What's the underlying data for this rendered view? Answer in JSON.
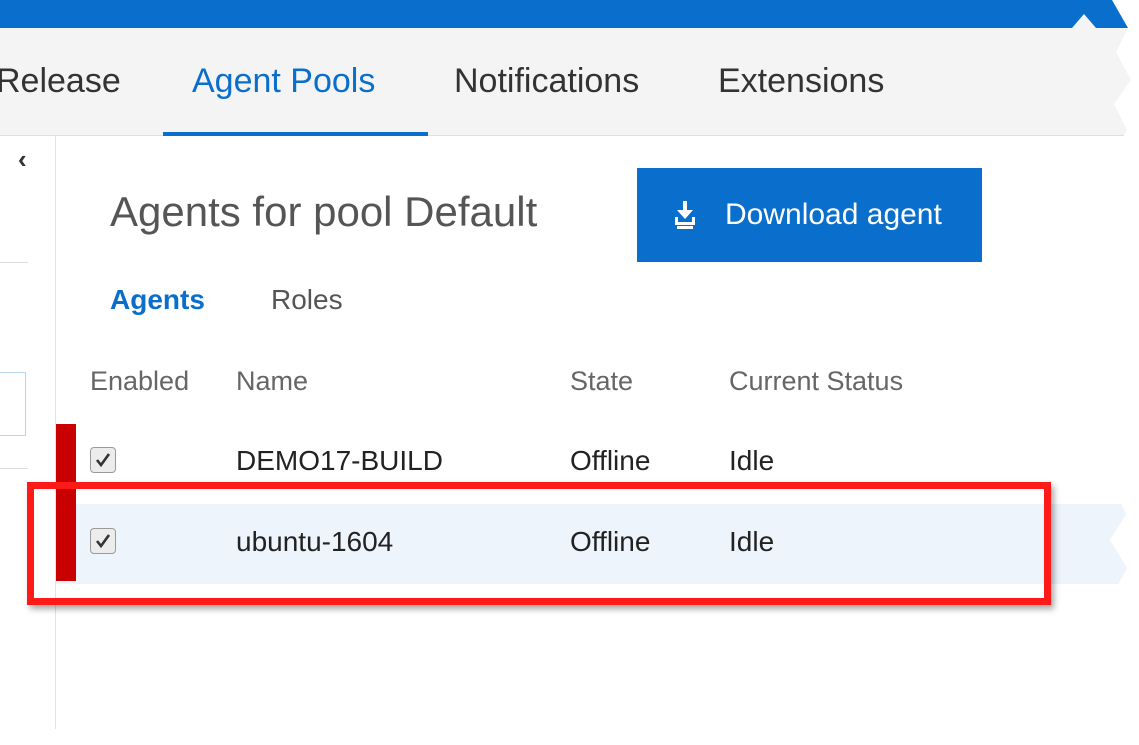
{
  "colors": {
    "accent": "#0a6fcc",
    "topbar": "#0a6fcc",
    "selected_row_bg": "#eef4fb",
    "highlight_annotation": "#ff1a1a",
    "selection_marker": "#c80000"
  },
  "hub_tabs": [
    {
      "label": "Release",
      "selected": false
    },
    {
      "label": "Agent Pools",
      "selected": true
    },
    {
      "label": "Notifications",
      "selected": false
    },
    {
      "label": "Extensions",
      "selected": false
    }
  ],
  "left_pane": {
    "collapse_icon": "chevron-left-icon",
    "collapse_glyph": "‹"
  },
  "page": {
    "title": "Agents for pool Default",
    "download_button": {
      "label": "Download agent",
      "icon": "download-icon"
    }
  },
  "pivots": [
    {
      "label": "Agents",
      "selected": true
    },
    {
      "label": "Roles",
      "selected": false
    }
  ],
  "agents_table": {
    "columns": [
      "Enabled",
      "Name",
      "State",
      "Current Status"
    ],
    "rows": [
      {
        "enabled": true,
        "name": "DEMO17-BUILD",
        "state": "Offline",
        "status": "Idle",
        "selected": false
      },
      {
        "enabled": true,
        "name": "ubuntu-1604",
        "state": "Offline",
        "status": "Idle",
        "selected": true
      }
    ]
  }
}
